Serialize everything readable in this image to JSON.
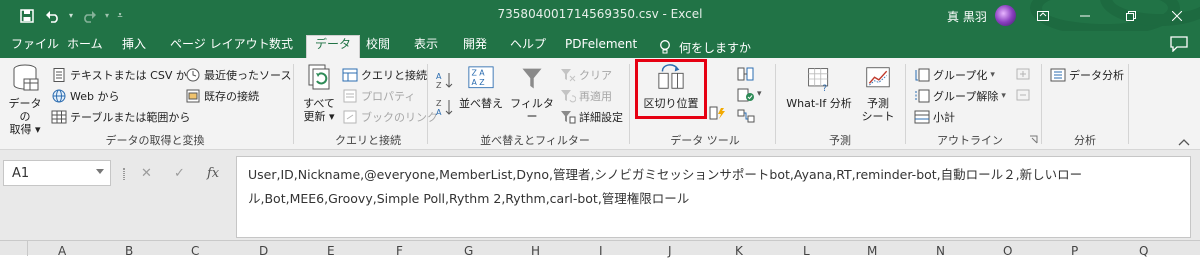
{
  "window": {
    "title": "735804001714569350.csv  -  Excel",
    "user_name": "真 黒羽"
  },
  "tabs": [
    "ファイル",
    "ホーム",
    "挿入",
    "ページ レイアウト",
    "数式",
    "データ",
    "校閲",
    "表示",
    "開発",
    "ヘルプ",
    "PDFelement"
  ],
  "active_tab": "データ",
  "tell_me": "何をしますか",
  "ribbon": {
    "get_transform": {
      "label": "データの取得と変換",
      "get_data": "データの\n取得",
      "from_text_csv": "テキストまたは CSV から",
      "from_web": "Web から",
      "from_table": "テーブルまたは範囲から",
      "recent_sources": "最近使ったソース",
      "existing_connections": "既存の接続"
    },
    "queries": {
      "label": "クエリと接続",
      "refresh_all": "すべて\n更新",
      "queries_connections": "クエリと接続",
      "properties": "プロパティ",
      "edit_links": "ブックのリンク"
    },
    "sort_filter": {
      "label": "並べ替えとフィルター",
      "sort": "並べ替え",
      "filter": "フィルター",
      "clear": "クリア",
      "reapply": "再適用",
      "advanced": "詳細設定"
    },
    "data_tools": {
      "label": "データ ツール",
      "text_to_columns": "区切り位置"
    },
    "forecast": {
      "label": "予測",
      "what_if": "What-If 分析",
      "forecast_sheet": "予測\nシート"
    },
    "outline": {
      "label": "アウトライン",
      "group": "グループ化",
      "ungroup": "グループ解除",
      "subtotal": "小計"
    },
    "analysis": {
      "label": "分析",
      "data_analysis": "データ分析"
    }
  },
  "formula_bar": {
    "name_box": "A1",
    "cancel": "✕",
    "enter": "✓",
    "fx": "fx",
    "formula": "User,ID,Nickname,@everyone,MemberList,Dyno,管理者,シノビガミセッションサポートbot,Ayana,RT,reminder-bot,自動ロール２,新しいロール,Bot,MEE6,Groovy,Simple Poll,Rythm 2,Rythm,carl-bot,管理権限ロール"
  },
  "columns": [
    "A",
    "B",
    "C",
    "D",
    "E",
    "F",
    "G",
    "H",
    "I",
    "J",
    "K",
    "L",
    "M",
    "N",
    "O",
    "P",
    "Q"
  ],
  "colors": {
    "excel_green": "#217346",
    "highlight_red": "#e60012"
  }
}
